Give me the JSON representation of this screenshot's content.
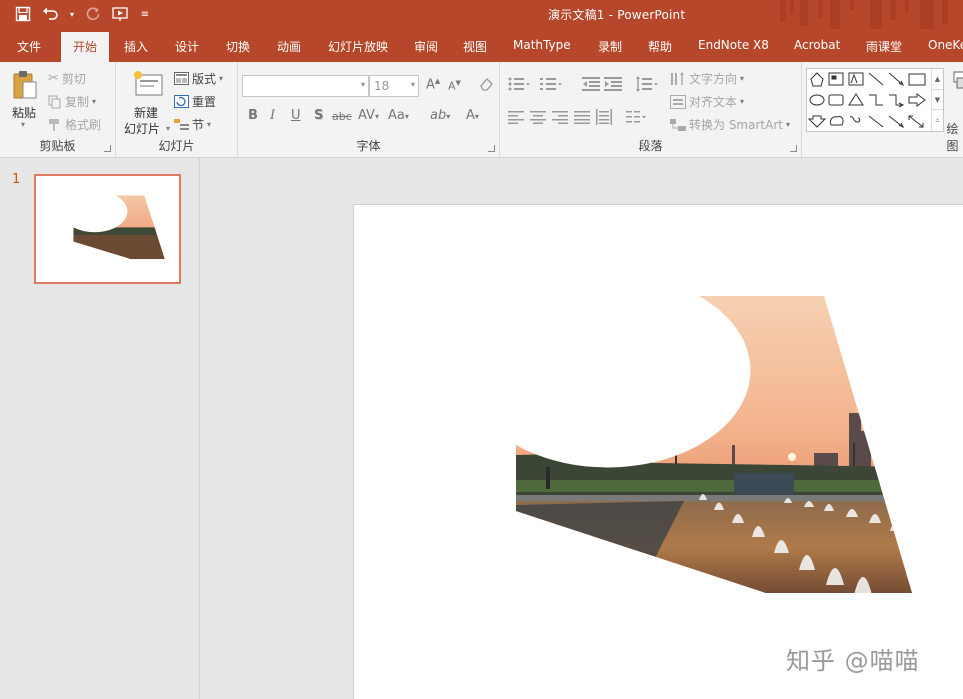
{
  "window": {
    "title": "演示文稿1  -  PowerPoint"
  },
  "tabs": [
    {
      "id": "file",
      "label": "文件"
    },
    {
      "id": "home",
      "label": "开始",
      "active": true
    },
    {
      "id": "insert",
      "label": "插入"
    },
    {
      "id": "design",
      "label": "设计"
    },
    {
      "id": "transitions",
      "label": "切换"
    },
    {
      "id": "animations",
      "label": "动画"
    },
    {
      "id": "slideshow",
      "label": "幻灯片放映"
    },
    {
      "id": "review",
      "label": "审阅"
    },
    {
      "id": "view",
      "label": "视图"
    },
    {
      "id": "mathtype",
      "label": "MathType"
    },
    {
      "id": "record",
      "label": "录制"
    },
    {
      "id": "help",
      "label": "帮助"
    },
    {
      "id": "endnote",
      "label": "EndNote X8"
    },
    {
      "id": "acrobat",
      "label": "Acrobat"
    },
    {
      "id": "yuketang",
      "label": "雨课堂"
    },
    {
      "id": "onekey",
      "label": "OneKe"
    }
  ],
  "ribbon": {
    "clipboard": {
      "label": "剪贴板",
      "paste": "粘贴",
      "cut": "剪切",
      "copy": "复制",
      "format_painter": "格式刷"
    },
    "slides": {
      "label": "幻灯片",
      "new_slide_line1": "新建",
      "new_slide_line2": "幻灯片",
      "layout": "版式",
      "reset": "重置",
      "section": "节"
    },
    "font": {
      "label": "字体",
      "font_name": "",
      "font_size": "18",
      "bold": "B",
      "italic": "I",
      "underline": "U",
      "shadow": "S",
      "strike": "abc",
      "spacing": "AV",
      "case": "Aa",
      "highlight": "ab",
      "color": "A",
      "grow": "A",
      "shrink": "A"
    },
    "paragraph": {
      "label": "段落",
      "text_direction": "文字方向",
      "align_text": "对齐文本",
      "convert_smartart": "转换为 SmartArt"
    },
    "drawing": {
      "label": "绘图"
    }
  },
  "thumbnails": [
    {
      "number": "1"
    }
  ],
  "watermark": "知乎 @喵喵",
  "colors": {
    "accent": "#b7472a",
    "thumb_border": "#e07a5f",
    "ribbon_bg": "#f3f3f3"
  }
}
